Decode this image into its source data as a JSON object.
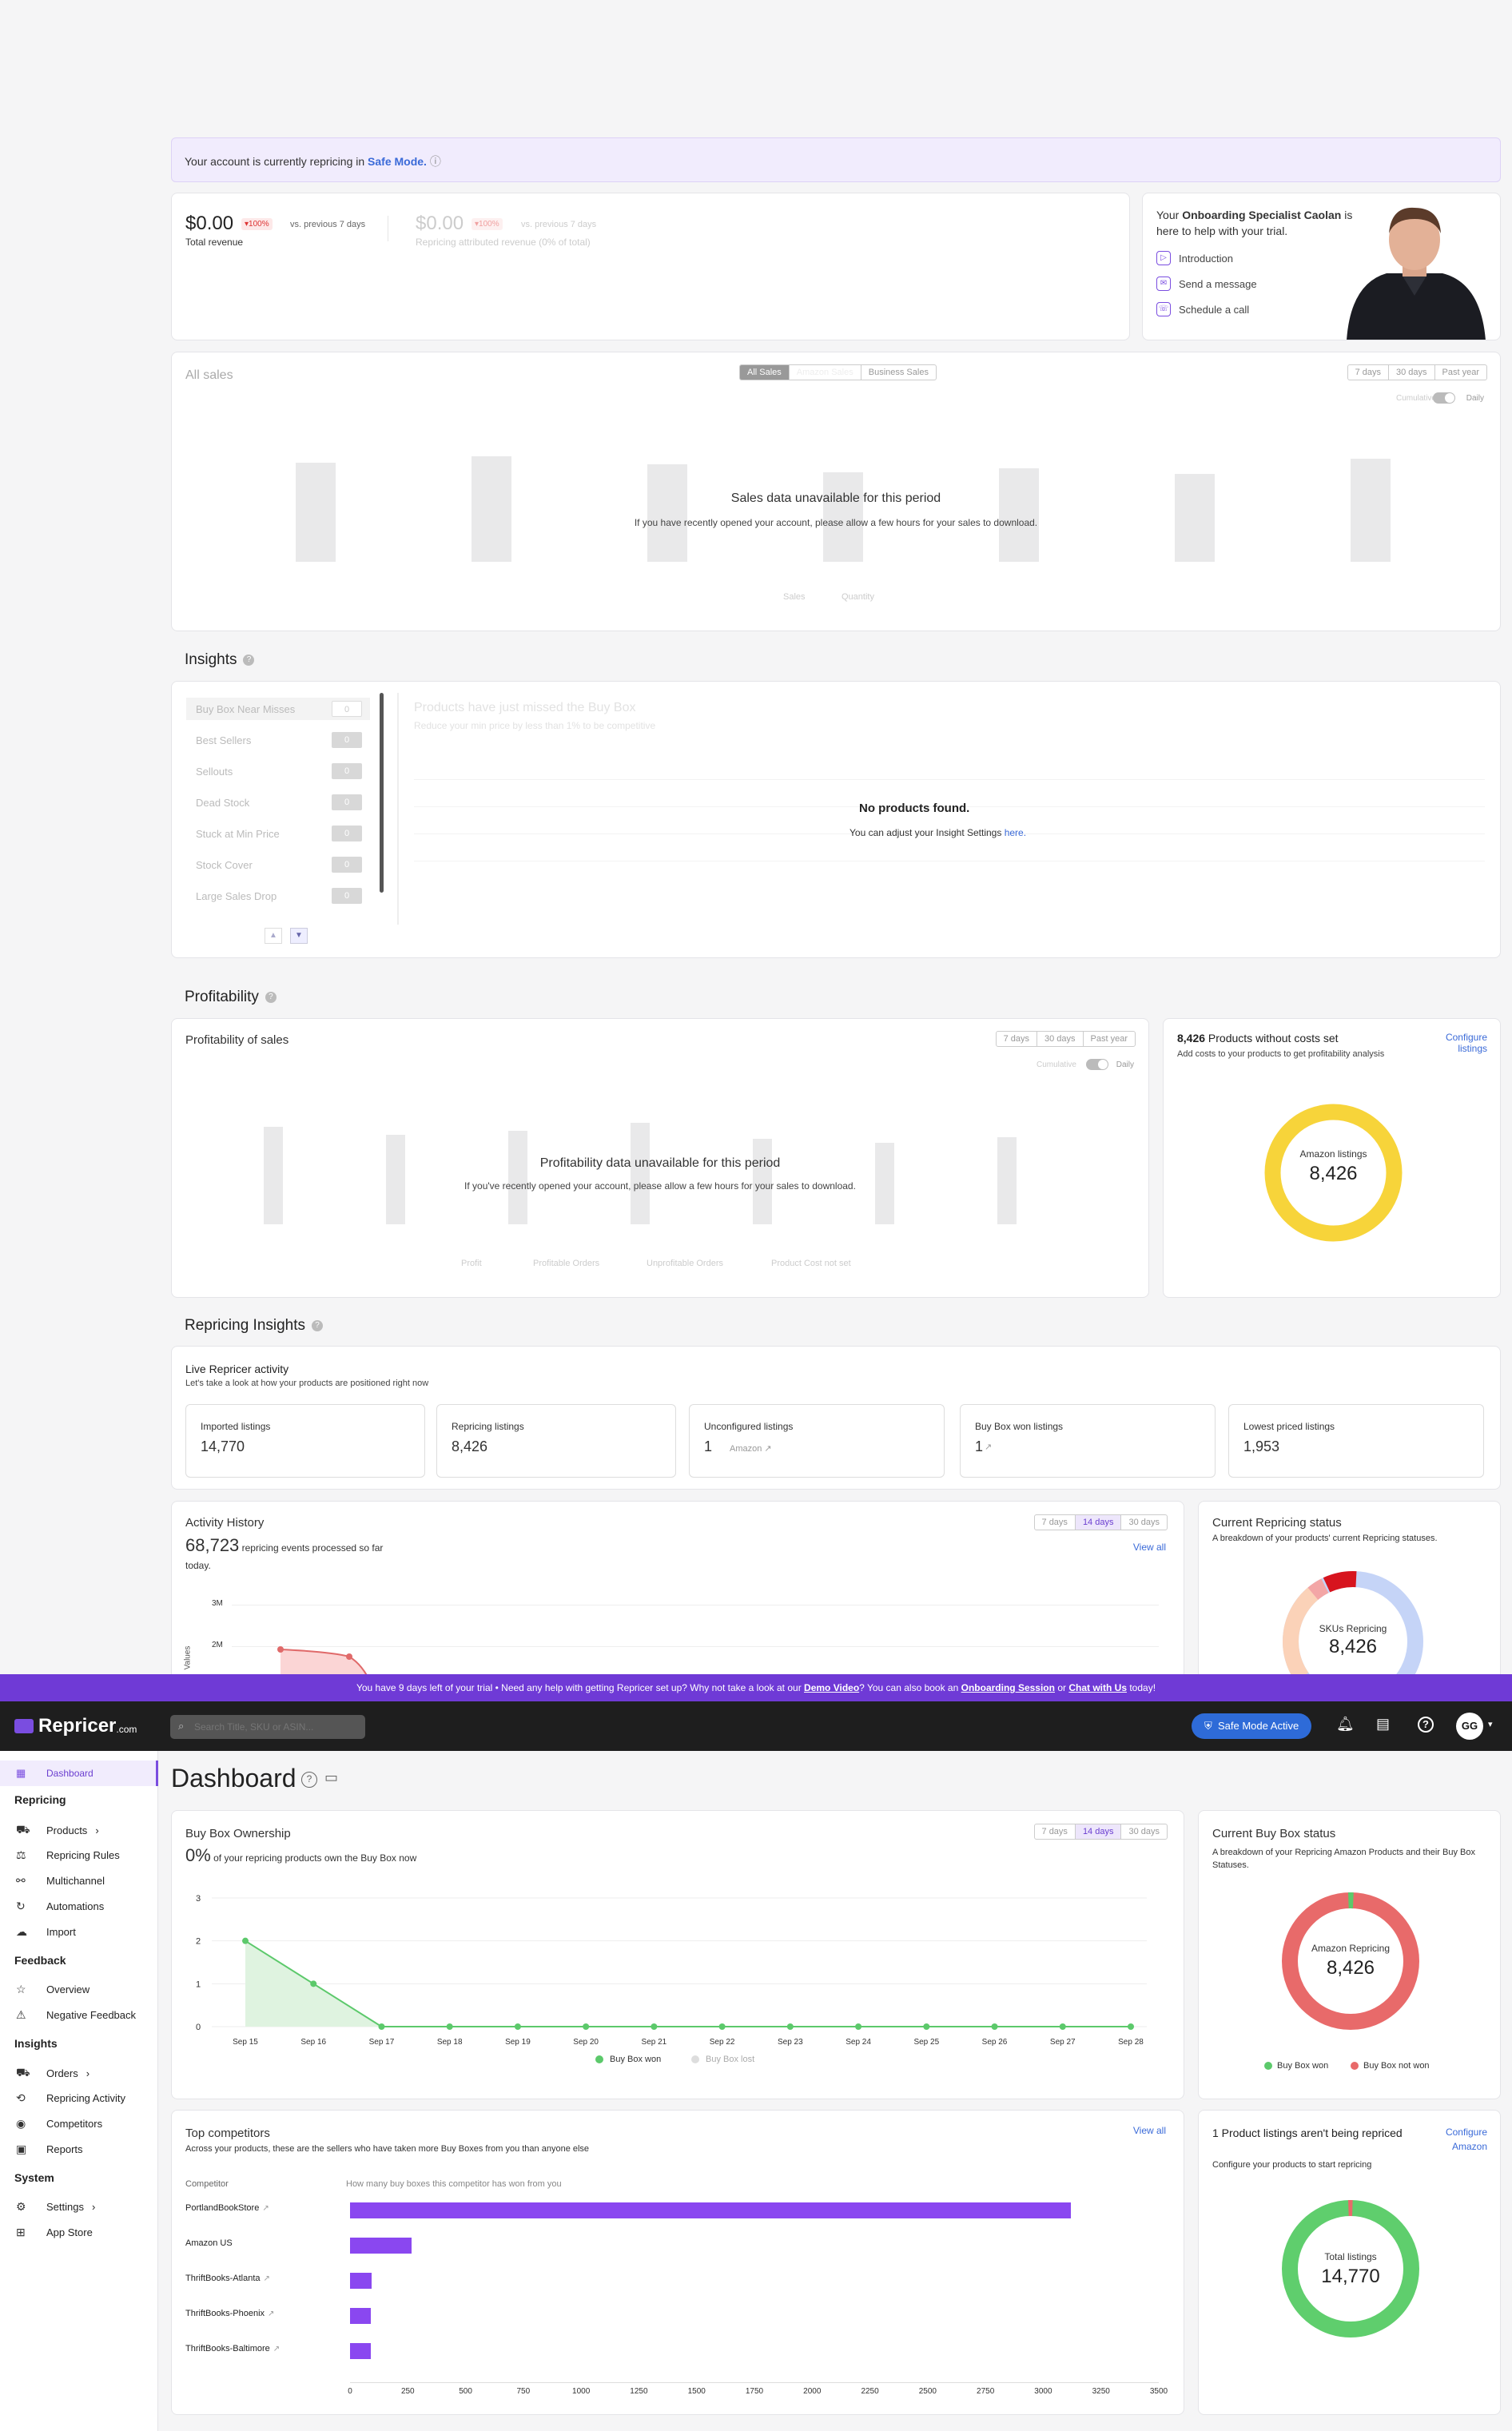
{
  "banner": {
    "text_prefix": "Your account is currently repricing in ",
    "mode": "Safe Mode.",
    "info": "ⓘ"
  },
  "revenue": {
    "total_value": "$0.00",
    "total_badge": "▾100%",
    "total_compare": "vs. previous 7 days",
    "total_label": "Total revenue",
    "attr_value": "$0.00",
    "attr_badge": "▾100%",
    "attr_compare": "vs. previous 7 days",
    "attr_label": "Repricing attributed revenue (0% of total)"
  },
  "onboarding": {
    "prefix": "Your ",
    "role": "Onboarding Specialist Caolan",
    "suffix": " is here to help with your trial.",
    "items": [
      "Introduction",
      "Send a message",
      "Schedule a call"
    ]
  },
  "all_sales": {
    "title": "All sales",
    "tabs": [
      "All Sales",
      "Amazon Sales",
      "Business Sales"
    ],
    "ranges": [
      "7 days",
      "30 days",
      "Past year"
    ],
    "cumulative": "Cumulative",
    "daily": "Daily",
    "empty_title": "Sales data unavailable for this period",
    "empty_sub": "If you have recently opened your account, please allow a few hours for your sales to download.",
    "legend": [
      "Sales",
      "Quantity"
    ]
  },
  "insights": {
    "title": "Insights",
    "items": [
      {
        "label": "Buy Box Near Misses",
        "count": "0"
      },
      {
        "label": "Best Sellers",
        "count": "0"
      },
      {
        "label": "Sellouts",
        "count": "0"
      },
      {
        "label": "Dead Stock",
        "count": "0"
      },
      {
        "label": "Stuck at Min Price",
        "count": "0"
      },
      {
        "label": "Stock Cover",
        "count": "0"
      },
      {
        "label": "Large Sales Drop",
        "count": "0"
      }
    ],
    "panel_title": "Products have just missed the Buy Box",
    "panel_sub": "Reduce your min price by less than 1% to be competitive",
    "empty_title": "No products found.",
    "empty_sub_prefix": "You can adjust your Insight Settings ",
    "empty_link": "here."
  },
  "profitability": {
    "title": "Profitability",
    "card_title": "Profitability of sales",
    "ranges": [
      "7 days",
      "30 days",
      "Past year"
    ],
    "cumulative": "Cumulative",
    "daily": "Daily",
    "empty_title": "Profitability data unavailable for this period",
    "empty_sub": "If you've recently opened your account, please allow a few hours for your sales to download.",
    "legend": [
      "Profit",
      "Profitable Orders",
      "Unprofitable Orders",
      "Product Cost not set"
    ],
    "costs_count": "8,426",
    "costs_title": " Products without costs set",
    "costs_sub": "Add costs to your products to get profitability analysis",
    "configure": "Configure listings",
    "donut_label": "Amazon listings",
    "donut_value": "8,426"
  },
  "repricing_insights": {
    "title": "Repricing Insights",
    "live_title": "Live Repricer activity",
    "live_sub": "Let's take a look at how your products are positioned right now",
    "stats": [
      {
        "label": "Imported listings",
        "value": "14,770"
      },
      {
        "label": "Repricing listings",
        "value": "8,426"
      },
      {
        "label": "Unconfigured listings",
        "value": "1",
        "extra": "Amazon ↗"
      },
      {
        "label": "Buy Box won listings",
        "value": "1",
        "extra": "↗"
      },
      {
        "label": "Lowest priced listings",
        "value": "1,953"
      }
    ]
  },
  "activity": {
    "title": "Activity History",
    "count": "68,723",
    "desc": " repricing events processed so far today.",
    "ranges": [
      "7 days",
      "14 days",
      "30 days"
    ],
    "view_all": "View all",
    "yticks": [
      "3M",
      "2M"
    ],
    "yaxis": "Values"
  },
  "current_status": {
    "title": "Current Repricing status",
    "sub": "A breakdown of your products' current Repricing statuses.",
    "donut_label": "SKUs Repricing",
    "donut_value": "8,426"
  },
  "trial_bar": {
    "prefix": "You have 9 days left of your trial  •  Need any help with getting Repricer set up?  Why not take a look at our ",
    "demo": "Demo Video",
    "mid": "?  You can also book an ",
    "session": "Onboarding Session",
    "or": " or ",
    "chat": "Chat with Us",
    "suffix": " today!"
  },
  "topbar": {
    "brand": "Repricer",
    "brand_suffix": ".com",
    "search_placeholder": "Search Title, SKU or ASIN...",
    "safe_mode": "Safe Mode Active",
    "avatar": "GG"
  },
  "sidebar": {
    "dashboard": "Dashboard",
    "groups": [
      {
        "title": "Repricing",
        "items": [
          "Products",
          "Repricing Rules",
          "Multichannel",
          "Automations",
          "Import"
        ]
      },
      {
        "title": "Feedback",
        "items": [
          "Overview",
          "Negative Feedback"
        ]
      },
      {
        "title": "Insights",
        "items": [
          "Orders",
          "Repricing Activity",
          "Competitors",
          "Reports"
        ]
      },
      {
        "title": "System",
        "items": [
          "Settings",
          "App Store"
        ]
      }
    ]
  },
  "page_title": "Dashboard",
  "buybox": {
    "title": "Buy Box Ownership",
    "pct": "0%",
    "desc": " of your repricing products own the Buy Box now",
    "ranges": [
      "7 days",
      "14 days",
      "30 days"
    ],
    "legend_won": "Buy Box won",
    "legend_lost": "Buy Box lost"
  },
  "buybox_status": {
    "title": "Current Buy Box status",
    "sub": "A breakdown of your Repricing Amazon Products and their Buy Box Statuses.",
    "donut_label": "Amazon Repricing",
    "donut_value": "8,426",
    "legend": [
      "Buy Box won",
      "Buy Box not won"
    ]
  },
  "competitors": {
    "title": "Top competitors",
    "sub": "Across your products, these are the sellers who have taken more Buy Boxes from you than anyone else",
    "view_all": "View all",
    "col1": "Competitor",
    "col2": "How many buy boxes this competitor has won from you"
  },
  "not_repriced": {
    "title": "1 Product listings aren't being repriced",
    "sub": "Configure your products to start repricing",
    "configure": "Configure Amazon",
    "donut_label": "Total listings",
    "donut_value": "14,770"
  },
  "colors": {
    "purple": "#6b3fd0",
    "dark": "#1e1e1e",
    "green": "#5cc96b",
    "red": "#e86a6a",
    "yellow": "#f7d43a",
    "blue": "#2e6bd8"
  },
  "chart_data": [
    {
      "type": "line",
      "title": "Buy Box Ownership",
      "x": [
        "Sep 15",
        "Sep 16",
        "Sep 17",
        "Sep 18",
        "Sep 19",
        "Sep 20",
        "Sep 21",
        "Sep 22",
        "Sep 23",
        "Sep 24",
        "Sep 25",
        "Sep 26",
        "Sep 27",
        "Sep 28"
      ],
      "series": [
        {
          "name": "Buy Box won",
          "values": [
            2,
            1,
            0,
            0,
            0,
            0,
            0,
            0,
            0,
            0,
            0,
            0,
            0,
            0
          ]
        }
      ],
      "yticks": [
        0,
        1,
        2,
        3
      ],
      "ylim": [
        0,
        3
      ]
    },
    {
      "type": "bar",
      "title": "Top competitors",
      "categories": [
        "PortlandBookStore",
        "Amazon US",
        "ThriftBooks-Atlanta",
        "ThriftBooks-Phoenix",
        "ThriftBooks-Baltimore"
      ],
      "values": [
        3120,
        265,
        95,
        90,
        90
      ],
      "xticks": [
        0,
        250,
        500,
        750,
        1000,
        1250,
        1500,
        1750,
        2000,
        2250,
        2500,
        2750,
        3000,
        3250,
        3500
      ],
      "xlim": [
        0,
        3500
      ]
    },
    {
      "type": "pie",
      "title": "Current Buy Box status",
      "labels": [
        "Buy Box won",
        "Buy Box not won"
      ],
      "values": [
        1,
        99
      ]
    },
    {
      "type": "pie",
      "title": "Product listings aren't being repriced",
      "labels": [
        "Repricing",
        "Not repricing"
      ],
      "values": [
        99,
        1
      ]
    }
  ]
}
